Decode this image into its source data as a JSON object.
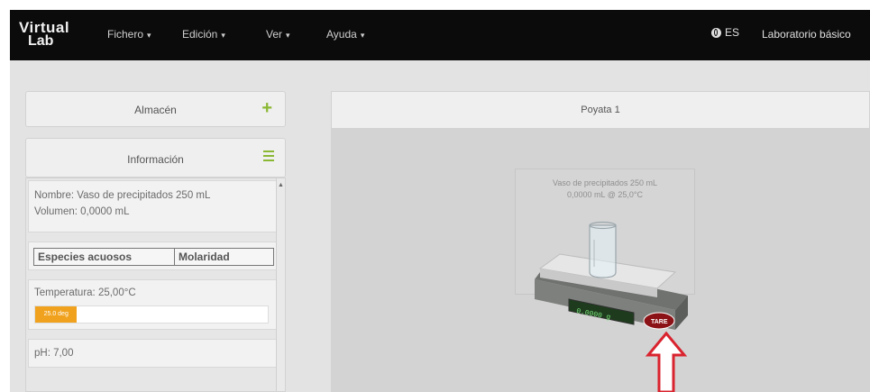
{
  "app": {
    "logo_line1": "Virtual",
    "logo_line2": "Lab"
  },
  "menu": [
    {
      "label": "Fichero"
    },
    {
      "label": "Edición"
    },
    {
      "label": "Ver"
    },
    {
      "label": "Ayuda"
    }
  ],
  "language": "ES",
  "lab_title": "Laboratorio básico",
  "sidebar": {
    "storage_title": "Almacén",
    "info_title": "Información",
    "info": {
      "name_line": "Nombre: Vaso de precipitados 250 mL",
      "volume_line": "Volumen: 0,0000 mL",
      "table_headers": [
        "Especies acuosos",
        "Molaridad"
      ],
      "temperature_line": "Temperatura: 25,00°C",
      "temperature_bar_label": "25.0 deg",
      "temperature_bar_fraction": 0.18,
      "ph_line": "pH: 7,00"
    }
  },
  "bench": {
    "title": "Poyata 1",
    "vessel_name": "Vaso de precipitados 250 mL",
    "vessel_readout": "0,0000 mL @ 25,0°C",
    "balance_display": "0.0000 g",
    "tare_label": "TARE"
  },
  "colors": {
    "navbar": "#0b0b0b",
    "accent_green": "#8ab833",
    "temp_orange": "#f0a21e",
    "arrow_red": "#d9232e"
  }
}
